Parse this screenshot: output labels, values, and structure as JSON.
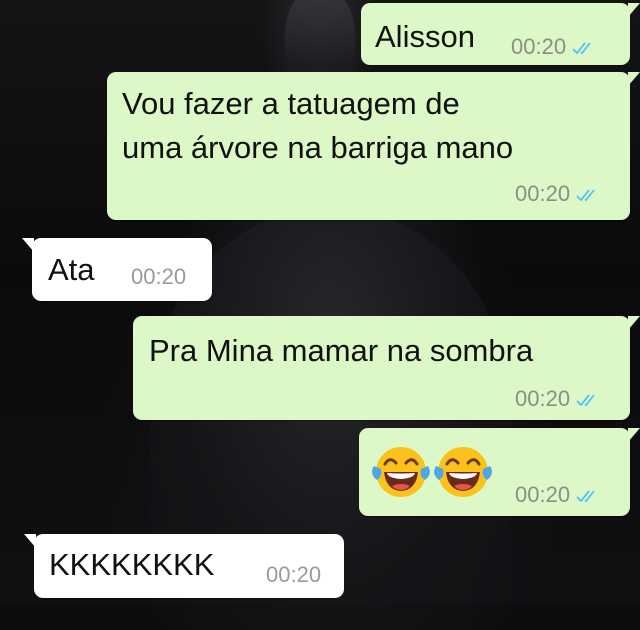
{
  "chat": {
    "tick_color": "#4fc3f7",
    "messages": [
      {
        "direction": "outgoing",
        "lines": [
          "Alisson"
        ],
        "time": "00:20",
        "status_icon": "double-check-icon"
      },
      {
        "direction": "outgoing",
        "lines": [
          "Vou fazer a tatuagem de",
          "uma árvore na barriga mano"
        ],
        "time": "00:20",
        "status_icon": "double-check-icon"
      },
      {
        "direction": "incoming",
        "lines": [
          "Ata"
        ],
        "time": "00:20"
      },
      {
        "direction": "outgoing",
        "lines": [
          "Pra Mina mamar na sombra"
        ],
        "time": "00:20",
        "status_icon": "double-check-icon"
      },
      {
        "direction": "outgoing",
        "emoji": [
          "face-with-tears-of-joy-emoji",
          "face-with-tears-of-joy-emoji"
        ],
        "time": "00:20",
        "status_icon": "double-check-icon"
      },
      {
        "direction": "incoming",
        "lines": [
          "KKKKKKKK"
        ],
        "time": "00:20"
      }
    ]
  }
}
